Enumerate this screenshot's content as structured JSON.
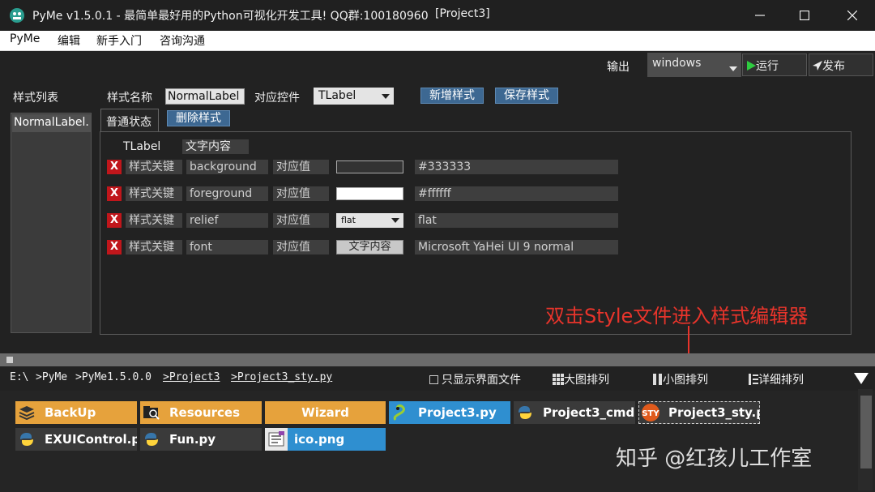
{
  "window": {
    "title": "PyMe v1.5.0.1 - 最简单最好用的Python可视化开发工具! QQ群:100180960",
    "project": "[Project3]"
  },
  "menu": [
    "PyMe",
    "编辑",
    "新手入门",
    "咨询沟通"
  ],
  "toolbar": {
    "output_label": "输出",
    "output_value": "windows",
    "run_label": "运行",
    "publish_label": "发布"
  },
  "style_list": {
    "label": "样式列表",
    "items": [
      "NormalLabel."
    ]
  },
  "style_editor": {
    "name_label": "样式名称",
    "name_value": "NormalLabel",
    "widget_label": "对应控件",
    "widget_value": "TLabel",
    "new_style": "新增样式",
    "save_style": "保存样式",
    "tab_normal": "普通状态",
    "delete_style": "删除样式",
    "control_name": "TLabel",
    "control_text": "文字内容",
    "rows": [
      {
        "x": "X",
        "key_label": "样式关键",
        "key": "background",
        "val_label": "对应值",
        "value": "#333333",
        "swatch": "#333333"
      },
      {
        "x": "X",
        "key_label": "样式关键",
        "key": "foreground",
        "val_label": "对应值",
        "value": "#ffffff",
        "swatch": "#ffffff"
      },
      {
        "x": "X",
        "key_label": "样式关键",
        "key": "relief",
        "val_label": "对应值",
        "value": "flat",
        "select": "flat"
      },
      {
        "x": "X",
        "key_label": "样式关键",
        "key": "font",
        "val_label": "对应值",
        "value": "Microsoft YaHei UI 9 normal",
        "button": "文字内容"
      }
    ]
  },
  "file_browser": {
    "path": [
      "E:\\",
      ">PyMe",
      ">PyMe1.5.0.0",
      ">Project3",
      ">Project3_sty.py"
    ],
    "only_ui_files": "只显示界面文件",
    "views": [
      "大图排列",
      "小图排列",
      "详细排列"
    ],
    "files": [
      {
        "name": "BackUp",
        "icon": "layers-icon",
        "color": "orange"
      },
      {
        "name": "Resources",
        "icon": "folder-search-icon",
        "color": "orange"
      },
      {
        "name": "Wizard",
        "icon": "none",
        "color": "orange"
      },
      {
        "name": "Project3.py",
        "icon": "snake-icon",
        "color": "blue"
      },
      {
        "name": "Project3_cmd",
        "icon": "python-icon",
        "color": "dark"
      },
      {
        "name": "Project3_sty.p",
        "icon": "sty-icon",
        "color": "dark"
      },
      {
        "name": "EXUIControl.p",
        "icon": "python-icon",
        "color": "dark"
      },
      {
        "name": "Fun.py",
        "icon": "python-icon",
        "color": "dark"
      },
      {
        "name": "ico.png",
        "icon": "image-file-icon",
        "color": "blue"
      }
    ]
  },
  "annotation": "双击Style文件进入样式编辑器",
  "watermark": "知乎 @红孩儿工作室",
  "colors": {
    "accent_blue": "#3d6892",
    "delete_red": "#c0161b",
    "annotation_red": "#e8342b",
    "folder_orange": "#e6a23c"
  }
}
